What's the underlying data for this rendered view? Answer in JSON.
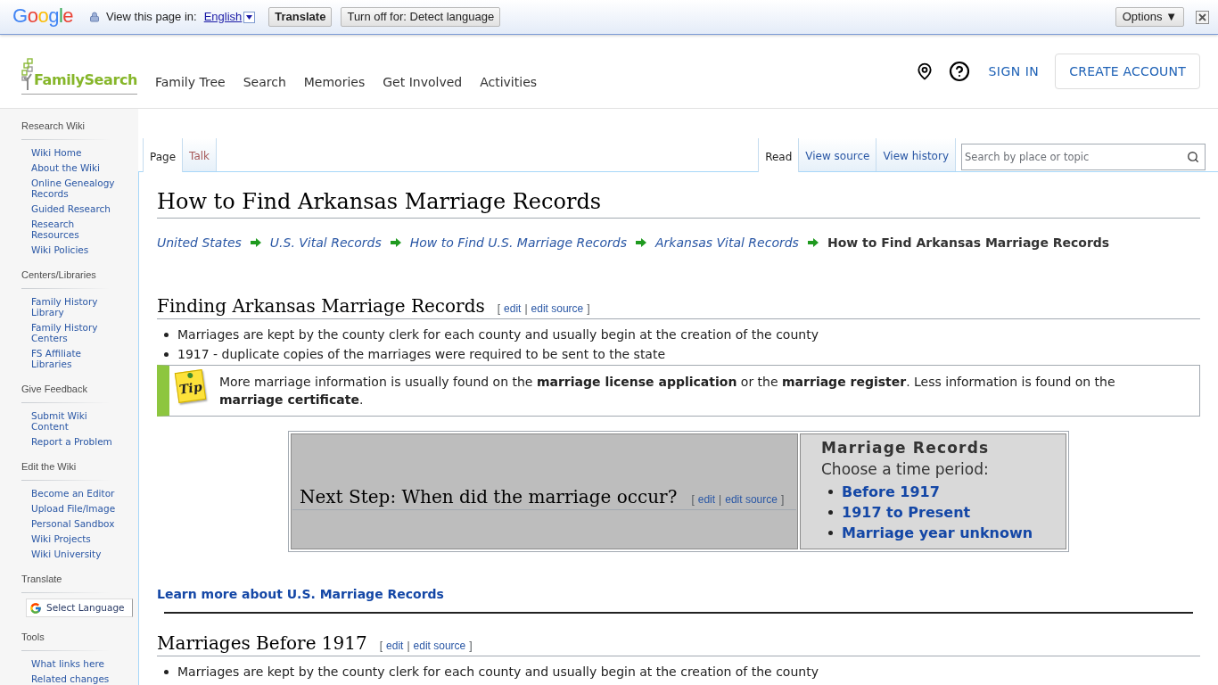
{
  "translate_bar": {
    "logo": "Google",
    "prompt": "View this page in:",
    "language": "English",
    "buttons": [
      {
        "label": "Translate",
        "kind": "primary"
      },
      {
        "label": "Turn off for: Detect language",
        "kind": "secondary"
      }
    ],
    "options": "Options ▼"
  },
  "header": {
    "logo": "FamilySearch",
    "nav": [
      "Family Tree",
      "Search",
      "Memories",
      "Get Involved",
      "Activities"
    ],
    "sign_in": "SIGN IN",
    "create_account": "CREATE ACCOUNT"
  },
  "sidebar": {
    "sections": [
      {
        "heading": "Research Wiki",
        "kind": "links",
        "items": [
          "Wiki Home",
          "About the Wiki",
          "Online Genealogy Records",
          "Guided Research",
          "Research Resources",
          "Wiki Policies"
        ]
      },
      {
        "heading": "Centers/Libraries",
        "kind": "links",
        "items": [
          "Family History Library",
          "Family History Centers",
          "FS Affiliate Libraries"
        ]
      },
      {
        "heading": "Give Feedback",
        "kind": "links",
        "items": [
          "Submit Wiki Content",
          "Report a Problem"
        ]
      },
      {
        "heading": "Edit the Wiki",
        "kind": "links",
        "items": [
          "Become an Editor",
          "Upload File/Image",
          "Personal Sandbox",
          "Wiki Projects",
          "Wiki University"
        ]
      },
      {
        "heading": "Translate",
        "kind": "language_select",
        "label": "Select Language"
      },
      {
        "heading": "Tools",
        "kind": "links",
        "items": [
          "What links here",
          "Related changes"
        ]
      }
    ]
  },
  "page_tabs": [
    {
      "label": "Page",
      "selected": true,
      "missing": false
    },
    {
      "label": "Talk",
      "selected": false,
      "missing": true
    }
  ],
  "view_tabs": [
    {
      "label": "Read",
      "selected": true
    },
    {
      "label": "View source",
      "selected": false
    },
    {
      "label": "View history",
      "selected": false
    }
  ],
  "search": {
    "placeholder": "Search by place or topic"
  },
  "article": {
    "title": "How to Find Arkansas Marriage Records",
    "breadcrumb": [
      {
        "label": "United States",
        "current": false
      },
      {
        "label": "U.S. Vital Records",
        "current": false
      },
      {
        "label": "How to Find U.S. Marriage Records",
        "current": false
      },
      {
        "label": "Arkansas Vital Records",
        "current": false
      },
      {
        "label": "How to Find Arkansas Marriage Records",
        "current": true
      }
    ],
    "blocks": [
      {
        "kind": "heading",
        "text": "Finding Arkansas Marriage Records",
        "edit": {
          "open": "[",
          "links": [
            "edit",
            "edit source"
          ],
          "separator": "|",
          "close": "]"
        }
      },
      {
        "kind": "bullets",
        "items": [
          "Marriages are kept by the county clerk for each county and usually begin at the creation of the county",
          "1917 - duplicate copies of the marriages were required to be sent to the state"
        ]
      },
      {
        "kind": "tip",
        "label": "Tip",
        "text": "More marriage information is usually found on the **marriage license application** or the **marriage register**. Less information is found on the **marriage certificate**."
      },
      {
        "kind": "next_step",
        "question": "Next Step: When did the marriage occur?",
        "edit": {
          "open": "[",
          "links": [
            "edit",
            "edit source"
          ],
          "separator": "|",
          "close": "]"
        },
        "panel_title": "Marriage Records",
        "panel_subtitle": "Choose a time period:",
        "options": [
          "Before 1917",
          "1917 to Present",
          "Marriage year unknown"
        ]
      },
      {
        "kind": "link",
        "text": "Learn more about U.S. Marriage Records"
      },
      {
        "kind": "rule"
      },
      {
        "kind": "heading",
        "text": "Marriages Before 1917",
        "edit": {
          "open": "[",
          "links": [
            "edit",
            "edit source"
          ],
          "separator": "|",
          "close": "]"
        }
      },
      {
        "kind": "bullets",
        "items": [
          "Marriages are kept by the county clerk for each county and usually begin at the creation of the county"
        ]
      }
    ]
  }
}
